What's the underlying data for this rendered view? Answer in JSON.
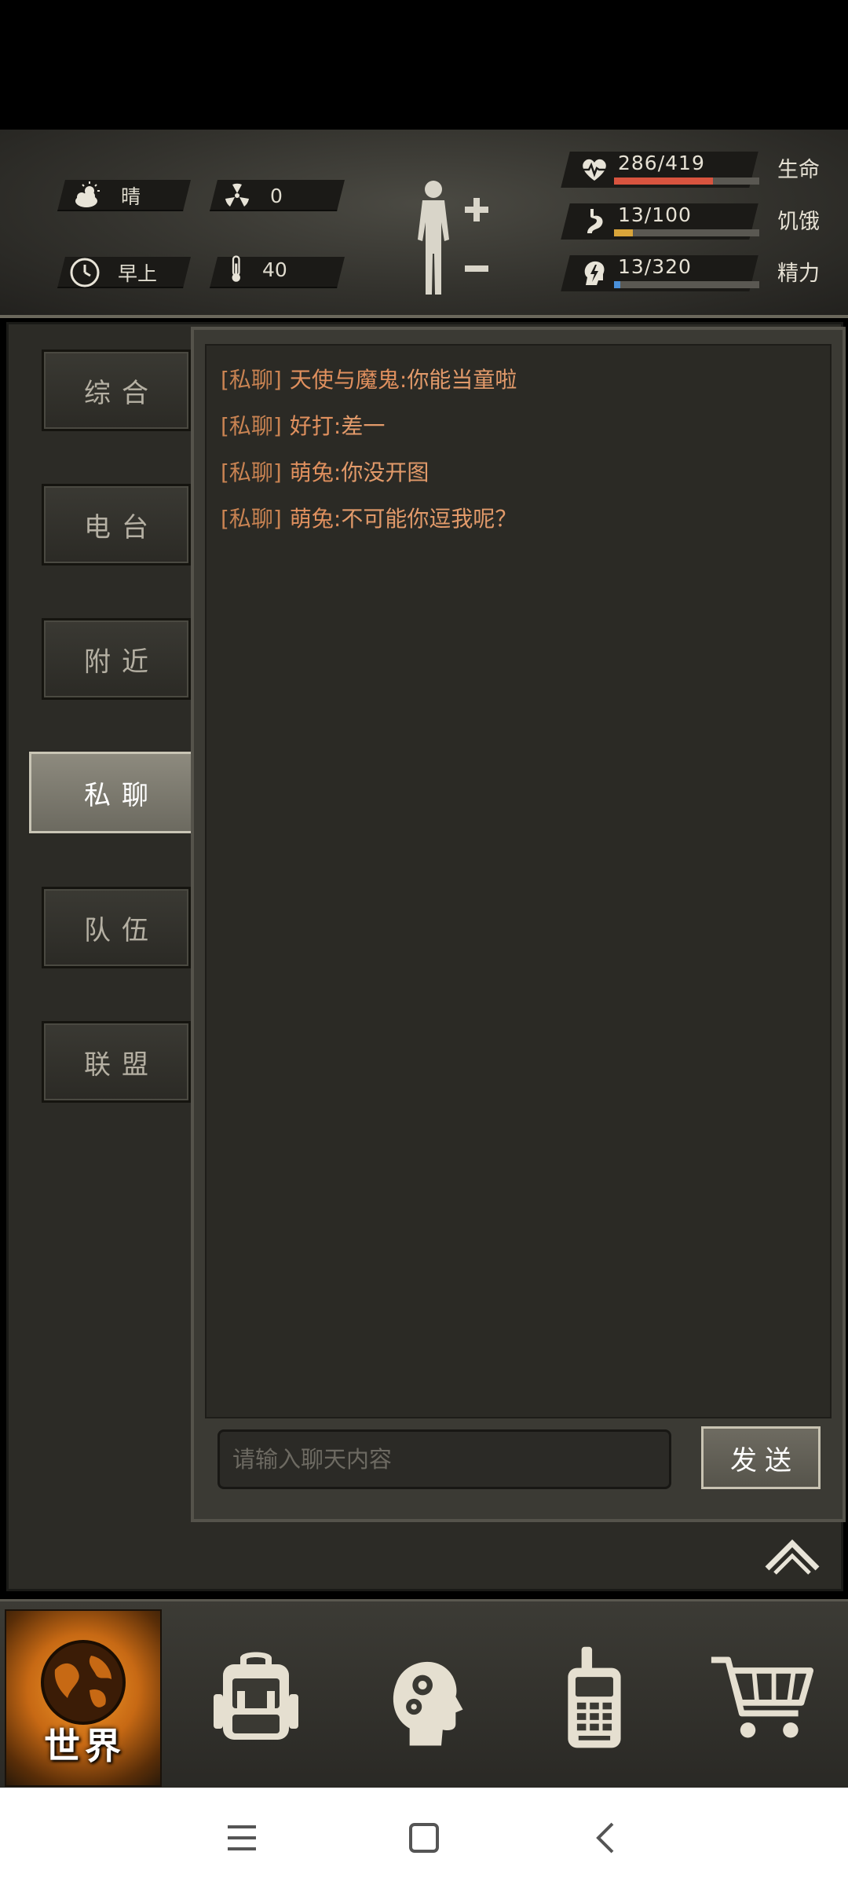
{
  "hud": {
    "weather": {
      "icon": "cloudy-sun-icon",
      "value": "晴"
    },
    "radiation": {
      "icon": "radiation-icon",
      "value": "0"
    },
    "time": {
      "icon": "clock-icon",
      "value": "早上"
    },
    "temperature": {
      "icon": "thermometer-icon",
      "value": "40"
    },
    "stats": [
      {
        "name": "health",
        "icon": "heart-pulse-icon",
        "text": "286/419",
        "label": "生命",
        "current": 286,
        "max": 419,
        "color": "#d8543f"
      },
      {
        "name": "hunger",
        "icon": "stomach-icon",
        "text": "13/100",
        "label": "饥饿",
        "current": 13,
        "max": 100,
        "color": "#d9a53a"
      },
      {
        "name": "energy",
        "icon": "brain-energy-icon",
        "text": "13/320",
        "label": "精力",
        "current": 13,
        "max": 320,
        "color": "#4a90d9"
      }
    ]
  },
  "tabs": [
    {
      "label": "综合",
      "active": false
    },
    {
      "label": "电台",
      "active": false
    },
    {
      "label": "附近",
      "active": false
    },
    {
      "label": "私聊",
      "active": true
    },
    {
      "label": "队伍",
      "active": false
    },
    {
      "label": "联盟",
      "active": false
    }
  ],
  "messages": [
    {
      "channel": "[私聊]",
      "sender": "天使与魔鬼",
      "separator": ":",
      "text": "你能当童啦"
    },
    {
      "channel": "[私聊]",
      "sender": "好打",
      "separator": ":",
      "text": "差一"
    },
    {
      "channel": "[私聊]",
      "sender": "萌兔",
      "separator": ":",
      "text": "你没开图"
    },
    {
      "channel": "[私聊]",
      "sender": "萌兔",
      "separator": ":",
      "text": "不可能你逗我呢？"
    }
  ],
  "chat_input": {
    "placeholder": "请输入聊天内容",
    "value": ""
  },
  "send_label": "发送",
  "bottom_nav": {
    "world_label": "世界",
    "items": [
      "globe-icon",
      "backpack-icon",
      "head-gears-icon",
      "walkie-talkie-icon",
      "shopping-cart-icon"
    ]
  },
  "system_nav": [
    "menu-icon",
    "home-icon",
    "back-icon"
  ]
}
